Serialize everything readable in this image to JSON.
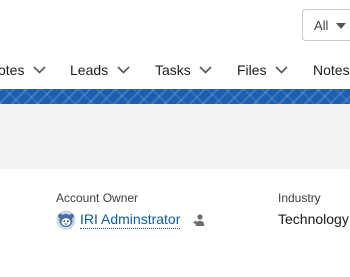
{
  "header": {
    "search_scope": {
      "selected": "All"
    }
  },
  "nav": {
    "items": [
      {
        "label": "otes"
      },
      {
        "label": "Leads"
      },
      {
        "label": "Tasks"
      },
      {
        "label": "Files"
      },
      {
        "label": "Notes"
      }
    ]
  },
  "record": {
    "account_owner": {
      "label": "Account Owner",
      "value": "IRI Adminstrator"
    },
    "industry": {
      "label": "Industry",
      "value": "Technology"
    }
  },
  "colors": {
    "brand_band": "#1b5fb0",
    "link": "#0b5cab",
    "highlight_panel": "#f3f3f3"
  },
  "icons": {
    "owner_avatar": "user-avatar-icon",
    "change_owner": "change-owner-icon",
    "dropdown": "chevron-down-icon"
  }
}
